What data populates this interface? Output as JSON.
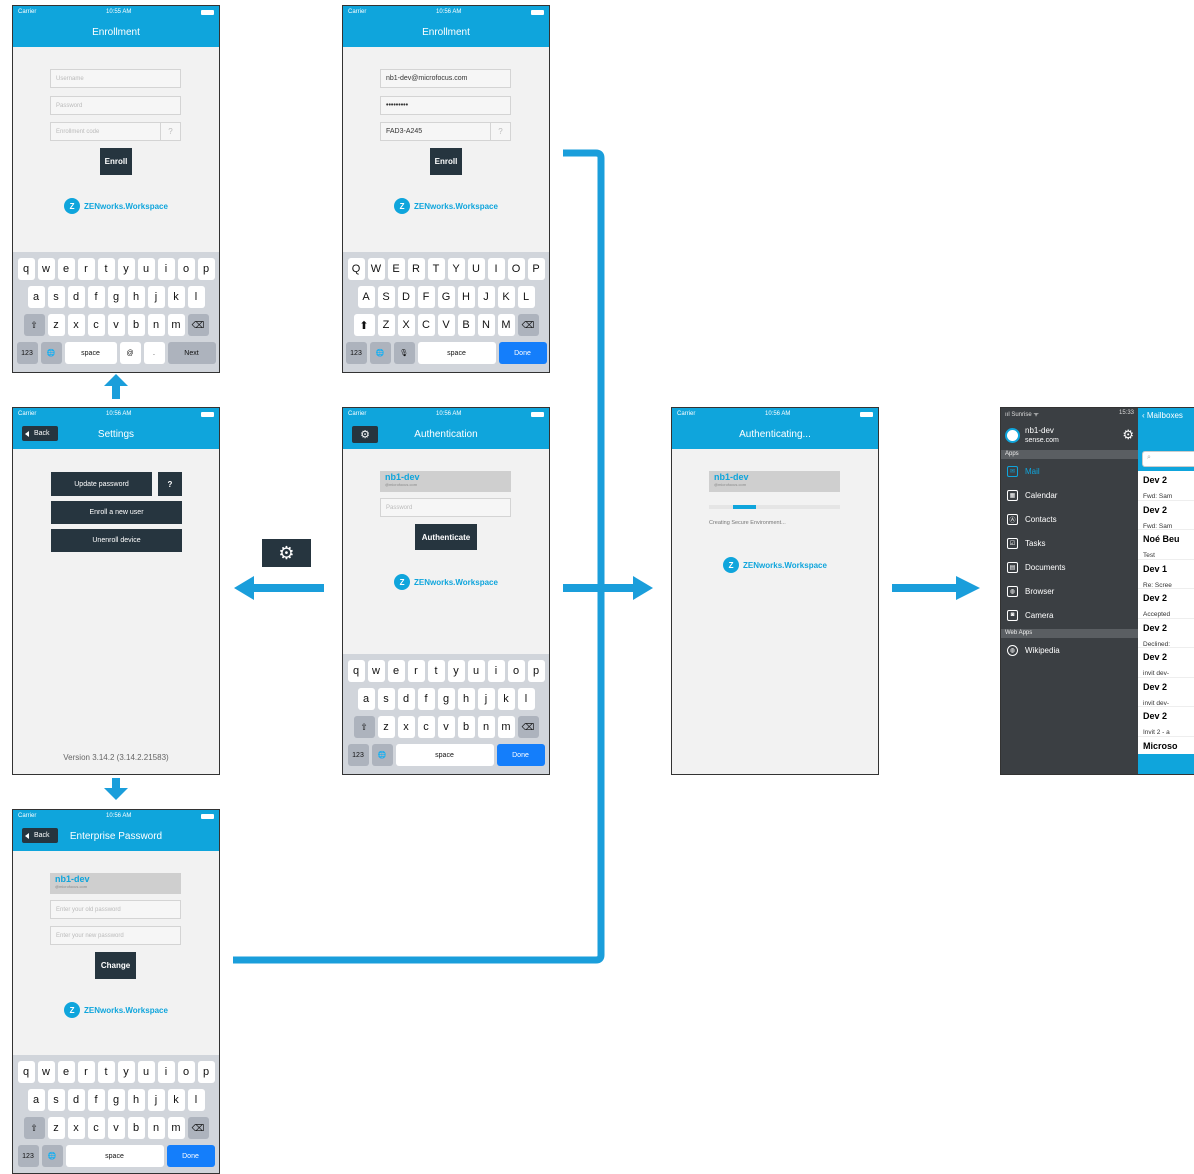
{
  "status": {
    "carrier": "Carrier",
    "wifi": "ᯤ",
    "t1": "10:55 AM",
    "t2": "10:56 AM"
  },
  "logo": {
    "text": "ZENworks.Workspace",
    "icon": "Z"
  },
  "enroll_empty": {
    "title": "Enrollment",
    "username_ph": "Username",
    "password_ph": "Password",
    "code_ph": "Enrollment code",
    "help": "?",
    "button": "Enroll"
  },
  "enroll_filled": {
    "title": "Enrollment",
    "username": "nb1-dev@microfocus.com",
    "password": "•••••••••",
    "code": "FAD3-A245",
    "help": "?",
    "button": "Enroll"
  },
  "settings": {
    "title": "Settings",
    "back": "Back",
    "update_pw": "Update password",
    "help": "?",
    "enroll_new": "Enroll a new user",
    "unenroll": "Unenroll device",
    "version": "Version 3.14.2 (3.14.2.21583)"
  },
  "auth": {
    "title": "Authentication",
    "user": "nb1-dev",
    "domain": "@microfocus.com",
    "password_ph": "Password",
    "button": "Authenticate"
  },
  "authenticating": {
    "title": "Authenticating...",
    "user": "nb1-dev",
    "domain": "@microfocus.com",
    "progress": 0.18,
    "status": "Creating Secure Environment..."
  },
  "enterprise": {
    "title": "Enterprise Password",
    "back": "Back",
    "user": "nb1-dev",
    "domain": "@microfocus.com",
    "old_ph": "Enter your old password",
    "new_ph": "Enter your new password",
    "button": "Change"
  },
  "keyboard": {
    "lower": [
      [
        "q",
        "w",
        "e",
        "r",
        "t",
        "y",
        "u",
        "i",
        "o",
        "p"
      ],
      [
        "a",
        "s",
        "d",
        "f",
        "g",
        "h",
        "j",
        "k",
        "l"
      ],
      [
        "z",
        "x",
        "c",
        "v",
        "b",
        "n",
        "m"
      ]
    ],
    "upper": [
      [
        "Q",
        "W",
        "E",
        "R",
        "T",
        "Y",
        "U",
        "I",
        "O",
        "P"
      ],
      [
        "A",
        "S",
        "D",
        "F",
        "G",
        "H",
        "J",
        "K",
        "L"
      ],
      [
        "Z",
        "X",
        "C",
        "V",
        "B",
        "N",
        "M"
      ]
    ],
    "num": "123",
    "space": "space",
    "at": "@",
    "dot": ".",
    "next": "Next",
    "done": "Done",
    "globe": "🌐",
    "mic": "🎙",
    "shift": "⇧",
    "shift_on": "⬆",
    "del": "⌫"
  },
  "app": {
    "status_left": "ııl Sunrise ᯤ",
    "status_time": "15:33",
    "user": "nb1-dev",
    "domain": "sense.com",
    "apps_label": "Apps",
    "items": [
      "Mail",
      "Calendar",
      "Contacts",
      "Tasks",
      "Documents",
      "Browser",
      "Camera"
    ],
    "webapps_label": "Web Apps",
    "web_items": [
      "Wikipedia"
    ],
    "mailboxes": "‹ Mailboxes",
    "mails": [
      [
        "Dev 2",
        "Fwd: Sam"
      ],
      [
        "Dev 2",
        "Fwd: Sam"
      ],
      [
        "Noé Beu",
        "Test"
      ],
      [
        "Dev 1",
        "Re: Scree"
      ],
      [
        "Dev 2",
        "Accepted"
      ],
      [
        "Dev 2",
        "Declined:"
      ],
      [
        "Dev 2",
        "invit dev-"
      ],
      [
        "Dev 2",
        "invit dev-"
      ],
      [
        "Dev 2",
        "Invit 2 - a"
      ],
      [
        "Microso",
        ""
      ]
    ]
  },
  "colors": {
    "accent": "#0fa5dc",
    "dark": "#26353f"
  },
  "icons": {
    "gear": "⚙"
  }
}
